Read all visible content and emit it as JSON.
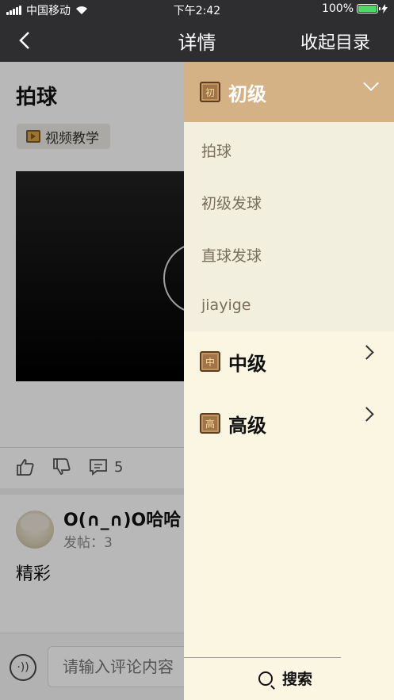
{
  "status_bar": {
    "carrier": "中国移动",
    "time": "下午2:42",
    "battery": "100%"
  },
  "nav": {
    "title": "详情",
    "collapse_label": "收起目录"
  },
  "post": {
    "title": "拍球",
    "tag": "视频教学"
  },
  "actions": {
    "comment_count": "5"
  },
  "comment": {
    "username": "O(∩_∩)O哈哈",
    "post_count": "发帖：3",
    "text": "精彩"
  },
  "input": {
    "placeholder": "请输入评论内容"
  },
  "drawer": {
    "levels": [
      {
        "label": "初级",
        "icon_char": "初",
        "expanded": true
      },
      {
        "label": "中级",
        "icon_char": "中",
        "expanded": false
      },
      {
        "label": "高级",
        "icon_char": "高",
        "expanded": false
      }
    ],
    "sub_items": [
      "拍球",
      "初级发球",
      "直球发球",
      "jiayige"
    ],
    "search_label": "搜索"
  },
  "colors": {
    "nav_bg": "#2e2e31",
    "drawer_bg": "#fbf6e2",
    "active_level_bg": "#d4b285",
    "sub_list_bg": "#f3efdf"
  }
}
